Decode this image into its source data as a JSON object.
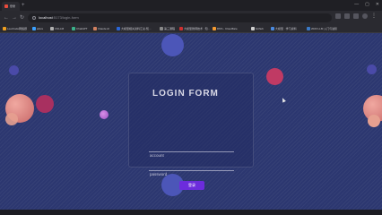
{
  "browser": {
    "tab_title": "登录",
    "new_tab_symbol": "+",
    "window_controls": [
      "—",
      "▢",
      "✕"
    ],
    "url_host": "localhost",
    "url_rest": ":5173/login-form",
    "bookmarks": [
      {
        "label": "LeetCode网络题",
        "color": "#f0a020"
      },
      {
        "label": "arkxx",
        "color": "#3aa0ff"
      },
      {
        "label": "CNLLM",
        "color": "#b0b0b0"
      },
      {
        "label": "ChatGPT",
        "color": "#3ab08a"
      },
      {
        "label": "Claude AI",
        "color": "#d08060"
      },
      {
        "label": "大模型相关资料汇总-知...",
        "color": "#2a66d8"
      },
      {
        "label": "第三课程",
        "color": "#8a8a8a"
      },
      {
        "label": "大模型微调技术 · 知...",
        "color": "#d03030"
      },
      {
        "label": "DNS - Cloudflare",
        "color": "#f59a30"
      },
      {
        "label": "Github",
        "color": "#cfcfcf"
      },
      {
        "label": "大模型 · 学习资料",
        "color": "#4a8ae0"
      },
      {
        "label": "2023 LLM 入门与进阶",
        "color": "#3a7ac8"
      }
    ]
  },
  "login": {
    "title": "LOGIN FORM",
    "account_placeholder": "account",
    "password_placeholder": "password",
    "submit_label": "登录"
  }
}
